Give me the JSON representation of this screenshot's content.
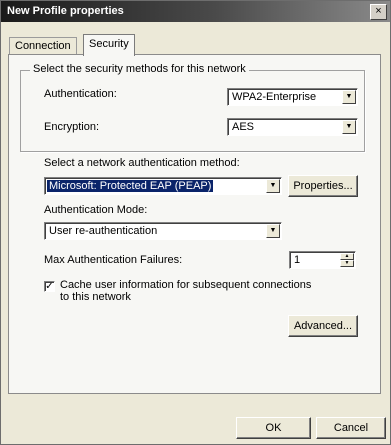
{
  "window": {
    "title": "New Profile properties",
    "close_glyph": "×"
  },
  "tabs": [
    {
      "label": "Connection"
    },
    {
      "label": "Security"
    }
  ],
  "security_group": {
    "legend": "Select the security methods for this network",
    "authentication_label": "Authentication:",
    "authentication_value": "WPA2-Enterprise",
    "encryption_label": "Encryption:",
    "encryption_value": "AES"
  },
  "auth_method": {
    "label": "Select a network authentication method:",
    "value": "Microsoft: Protected EAP (PEAP)",
    "properties_button": "Properties..."
  },
  "auth_mode": {
    "label": "Authentication Mode:",
    "value": "User re-authentication"
  },
  "max_failures": {
    "label": "Max Authentication Failures:",
    "value": "1"
  },
  "cache": {
    "label_line1": "Cache user information for subsequent connections",
    "label_line2": "to this network",
    "checked": true
  },
  "advanced_button": "Advanced...",
  "footer": {
    "ok": "OK",
    "cancel": "Cancel"
  }
}
